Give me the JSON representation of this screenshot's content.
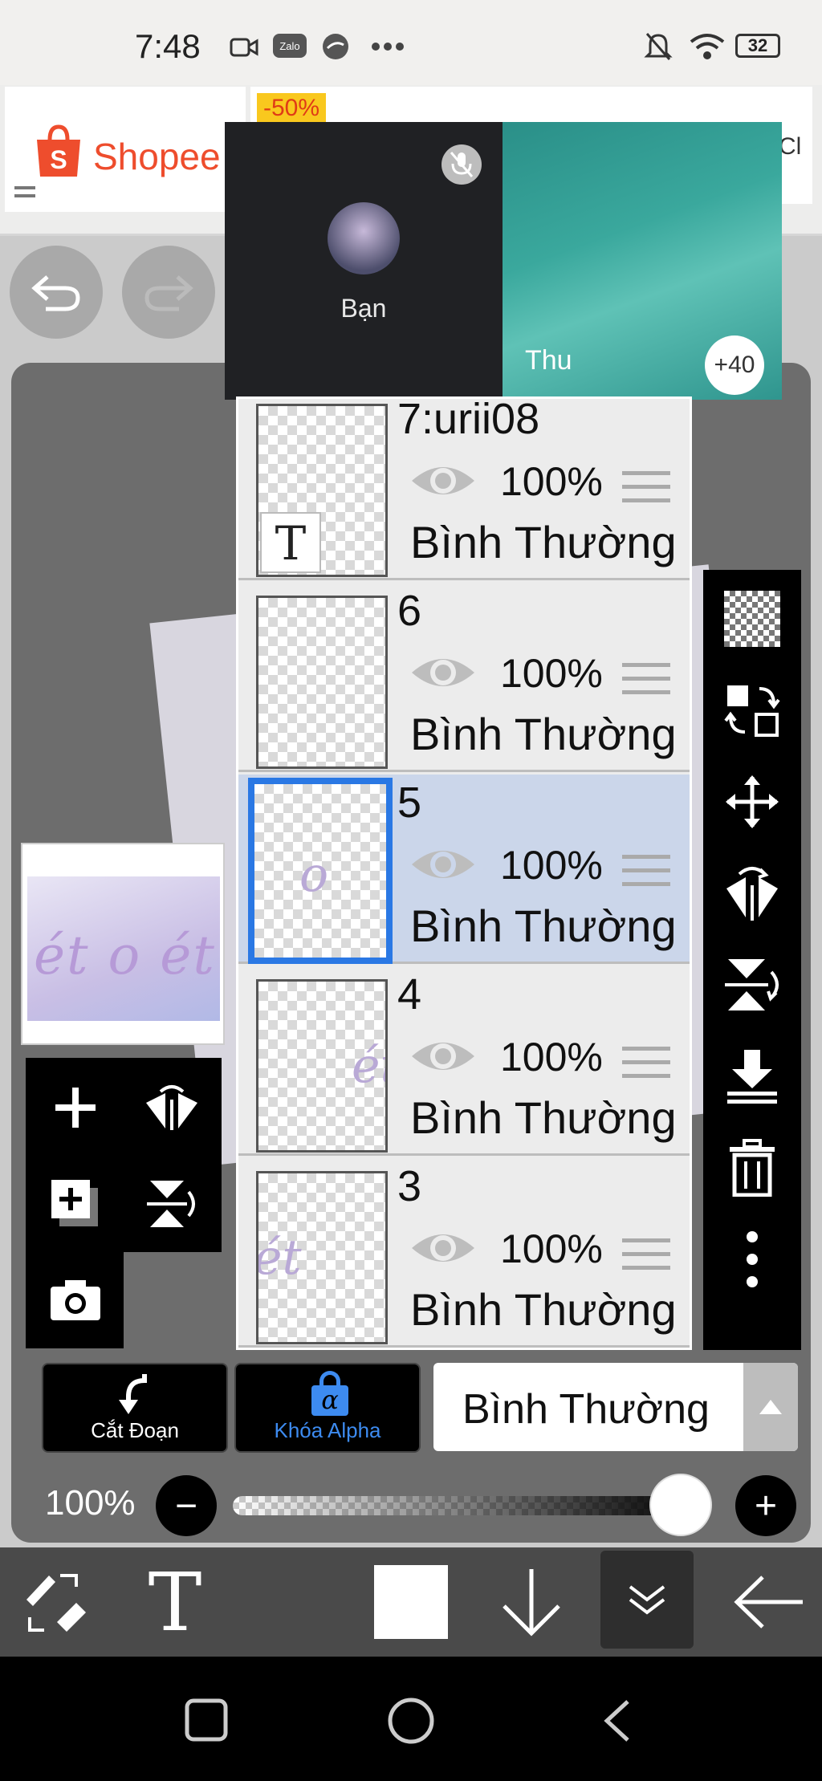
{
  "status_bar": {
    "time": "7:48",
    "carrier_badge": "Zalo",
    "battery": "32"
  },
  "ad": {
    "brand": "Shopee",
    "discount": "-50%",
    "clipped_text": "Cl"
  },
  "video_call": {
    "self_name": "Bạn",
    "other_name": "Thu",
    "more_count": "+40"
  },
  "layers": [
    {
      "name": "7:urii08",
      "opacity": "100%",
      "mode": "Bình Thường",
      "thumb_glyph": "T",
      "selected": false
    },
    {
      "name": "6",
      "opacity": "100%",
      "mode": "Bình Thường",
      "thumb_glyph": "",
      "selected": false
    },
    {
      "name": "5",
      "opacity": "100%",
      "mode": "Bình Thường",
      "thumb_glyph": "o",
      "selected": true
    },
    {
      "name": "4",
      "opacity": "100%",
      "mode": "Bình Thường",
      "thumb_glyph": "ét",
      "selected": false
    },
    {
      "name": "3",
      "opacity": "100%",
      "mode": "Bình Thường",
      "thumb_glyph": "ét",
      "selected": false
    }
  ],
  "thumbnail": {
    "text": "ét o ét"
  },
  "actions": {
    "clipping_label": "Cắt Đoạn",
    "alpha_lock_label": "Khóa Alpha",
    "alpha_glyph": "α"
  },
  "blend_mode": {
    "value": "Bình Thường"
  },
  "opacity": {
    "label": "100%",
    "minus": "−",
    "plus": "+",
    "value": 1.0
  },
  "bottom_tools": {
    "text_tool": "T"
  },
  "colors": {
    "selected_border": "#2a78e4",
    "selected_row": "#cbd6ea",
    "alpha_lock_text": "#3d8bf0",
    "shopee_orange": "#ee4d2d"
  }
}
